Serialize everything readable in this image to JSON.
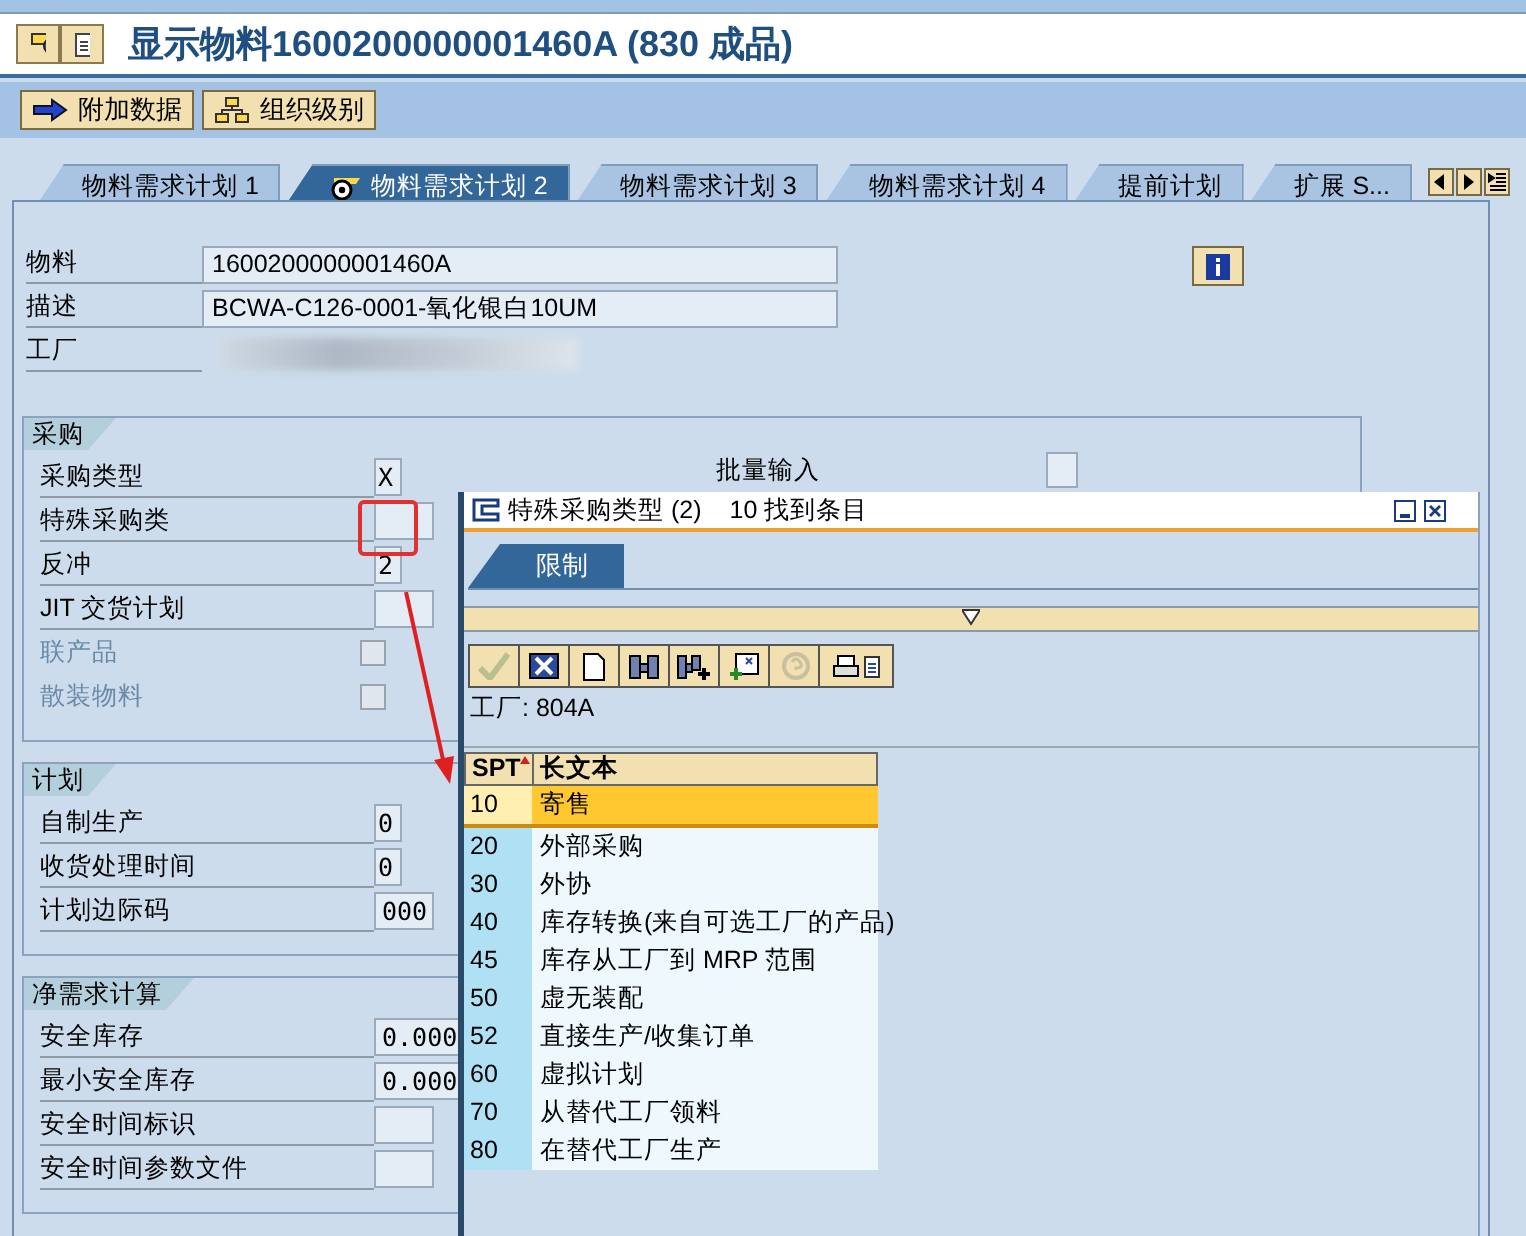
{
  "window": {
    "title": "显示物料1600200000001460A (830 成品)"
  },
  "toolbar": [
    "附加数据",
    "组织级别"
  ],
  "tabs": [
    {
      "label": "物料需求计划 1",
      "selected": false
    },
    {
      "label": "物料需求计划 2",
      "selected": true
    },
    {
      "label": "物料需求计划 3",
      "selected": false
    },
    {
      "label": "物料需求计划 4",
      "selected": false
    },
    {
      "label": "提前计划",
      "selected": false
    },
    {
      "label": "扩展 S...",
      "selected": false
    }
  ],
  "header_fields": [
    {
      "label": "物料",
      "value": "1600200000001460A"
    },
    {
      "label": "描述",
      "value": "BCWA-C126-0001-氧化银白10UM"
    },
    {
      "label": "工厂"
    }
  ],
  "groups": [
    {
      "title": "采购",
      "side_label": "批量输入",
      "rows": [
        {
          "kind": "field",
          "label": "采购类型",
          "value": "X"
        },
        {
          "kind": "field",
          "label": "特殊采购类"
        },
        {
          "kind": "field",
          "label": "反冲",
          "value": "2"
        },
        {
          "kind": "field",
          "label": "JIT 交货计划"
        },
        {
          "kind": "checkbox",
          "label": "联产品",
          "checked": false,
          "disabled": true
        },
        {
          "kind": "checkbox",
          "label": "散装物料",
          "checked": false,
          "disabled": true
        }
      ]
    },
    {
      "title": "计划",
      "rows": [
        {
          "kind": "field",
          "label": "自制生产",
          "value": "0"
        },
        {
          "kind": "field",
          "label": "收货处理时间",
          "value": "0"
        },
        {
          "kind": "field",
          "label": "计划边际码",
          "value": "000"
        }
      ]
    },
    {
      "title": "净需求计算",
      "rows": [
        {
          "kind": "field",
          "label": "安全库存",
          "value": "0.000"
        },
        {
          "kind": "field",
          "label": "最小安全库存",
          "value": "0.000"
        },
        {
          "kind": "field",
          "label": "安全时间标识"
        },
        {
          "kind": "field",
          "label": "安全时间参数文件"
        }
      ]
    }
  ],
  "popup": {
    "title": "特殊采购类型 (2)",
    "count": "10 找到条目",
    "tab": "限制",
    "filter": "工厂: 804A",
    "columns": [
      "SPT",
      "长文本"
    ],
    "rows": [
      {
        "code": "10",
        "text": "寄售",
        "selected": true
      },
      {
        "code": "20",
        "text": "外部采购",
        "selected": false
      },
      {
        "code": "30",
        "text": "外协",
        "selected": false
      },
      {
        "code": "40",
        "text": "库存转换(来自可选工厂的产品)",
        "selected": false
      },
      {
        "code": "45",
        "text": "库存从工厂到 MRP 范围",
        "selected": false
      },
      {
        "code": "50",
        "text": "虚无装配",
        "selected": false
      },
      {
        "code": "52",
        "text": "直接生产/收集订单",
        "selected": false
      },
      {
        "code": "60",
        "text": "虚拟计划",
        "selected": false
      },
      {
        "code": "70",
        "text": "从替代工厂领料",
        "selected": false
      },
      {
        "code": "80",
        "text": "在替代工厂生产",
        "selected": false
      }
    ]
  }
}
